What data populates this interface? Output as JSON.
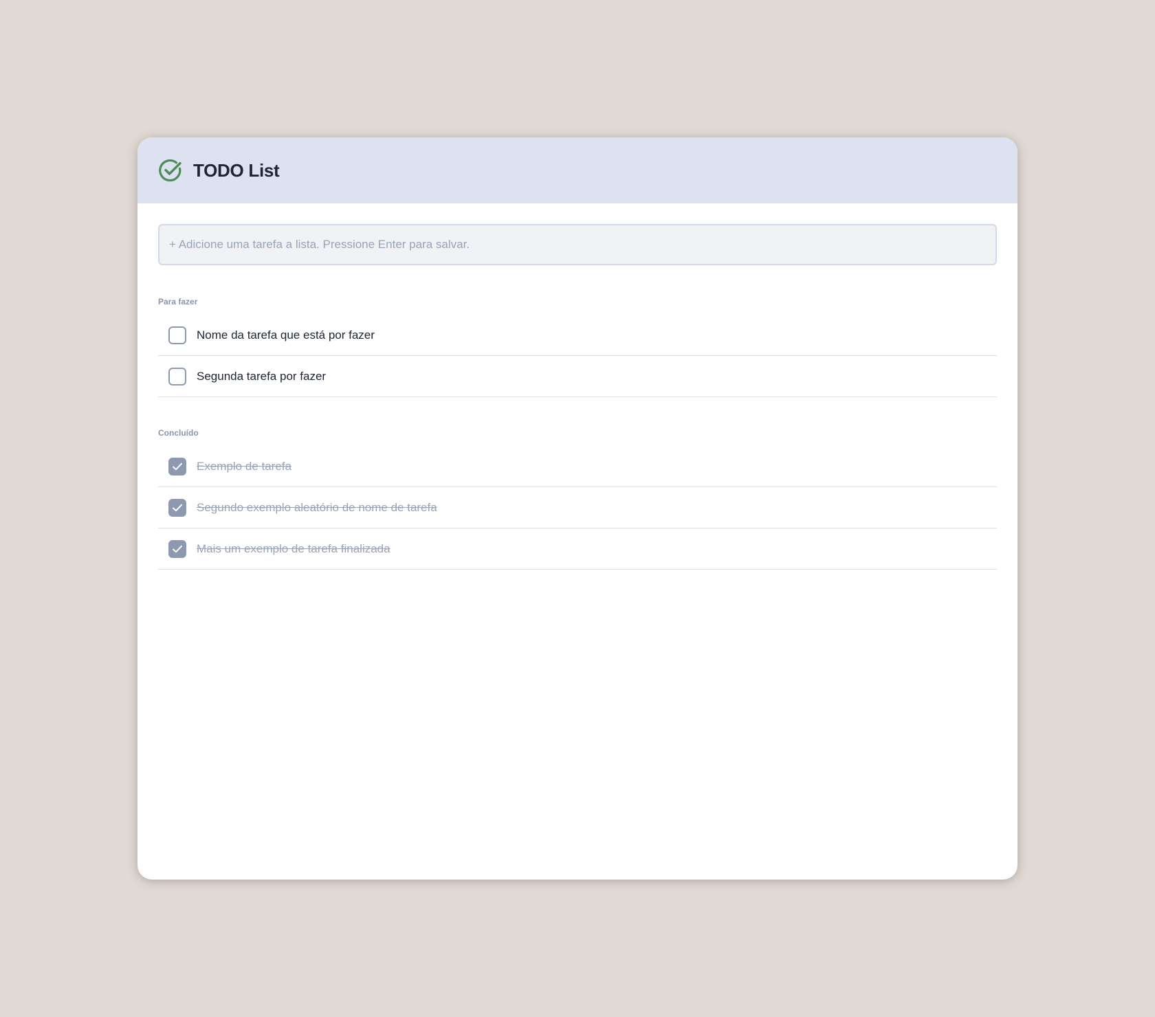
{
  "app": {
    "title": "TODO List",
    "logo_icon": "check-circle-icon",
    "accent_color": "#4f8a5b",
    "header_color": "#dce2ef"
  },
  "add_task": {
    "placeholder": "+ Adicione uma tarefa a lista. Pressione Enter para salvar.",
    "value": ""
  },
  "sections": {
    "todo": {
      "label": "Para fazer",
      "tasks": [
        {
          "text": "Nome da tarefa que está por fazer",
          "done": false
        },
        {
          "text": "Segunda tarefa por fazer",
          "done": false
        }
      ]
    },
    "done": {
      "label": "Concluído",
      "tasks": [
        {
          "text": "Exemplo de tarefa",
          "done": true
        },
        {
          "text": "Segundo exemplo aleatório de nome de tarefa",
          "done": true
        },
        {
          "text": "Mais um exemplo de tarefa finalizada",
          "done": true
        }
      ]
    }
  }
}
